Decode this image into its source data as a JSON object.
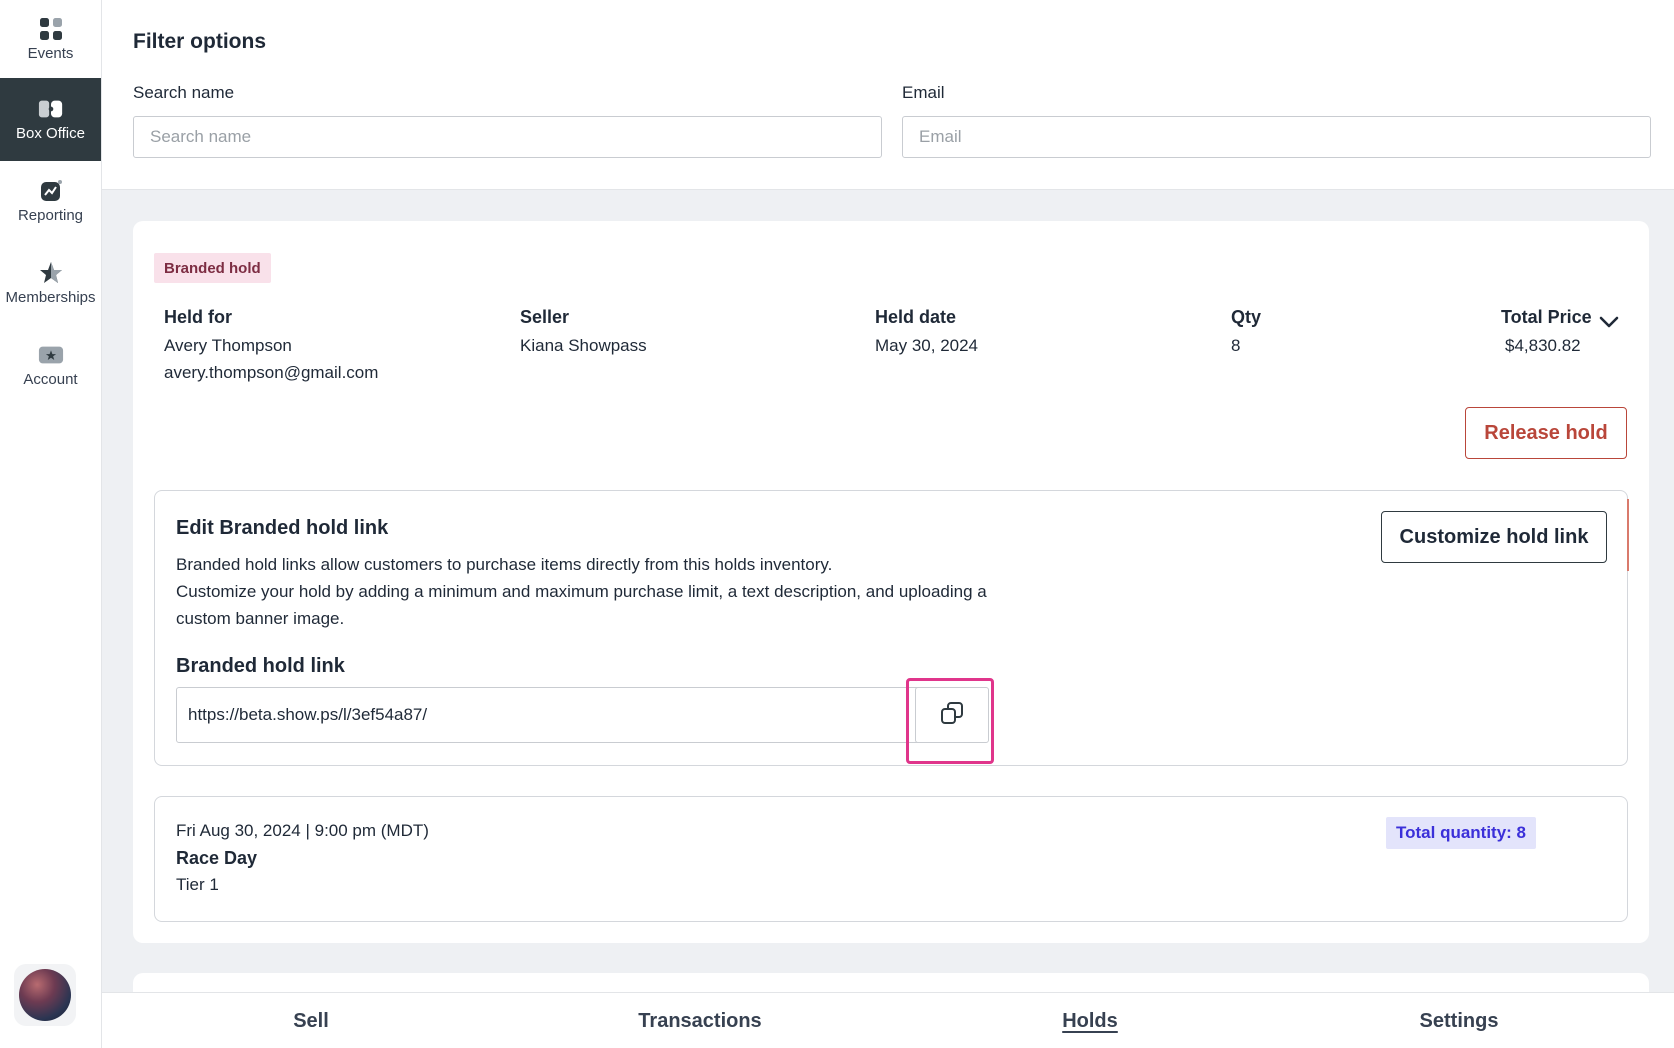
{
  "sidebar": {
    "items": [
      {
        "label": "Events",
        "icon": "grid-icon",
        "active": false
      },
      {
        "label": "Box Office",
        "icon": "box-office-icon",
        "active": true
      },
      {
        "label": "Reporting",
        "icon": "chart-icon",
        "active": false
      },
      {
        "label": "Memberships",
        "icon": "star-icon",
        "active": false
      },
      {
        "label": "Account",
        "icon": "account-badge-icon",
        "active": false
      }
    ],
    "avatar_icon": "user-avatar"
  },
  "filter": {
    "title": "Filter options",
    "search_label": "Search name",
    "search_placeholder": "Search name",
    "email_label": "Email",
    "email_placeholder": "Email"
  },
  "hold": {
    "badge": "Branded hold",
    "columns": {
      "held_for_label": "Held for",
      "held_for_name": "Avery Thompson",
      "held_for_email": "avery.thompson@gmail.com",
      "seller_label": "Seller",
      "seller_value": "Kiana Showpass",
      "held_date_label": "Held date",
      "held_date_value": "May 30, 2024",
      "qty_label": "Qty",
      "qty_value": "8",
      "total_label": "Total Price",
      "total_value": "$4,830.82"
    },
    "release_button": "Release hold",
    "edit": {
      "title": "Edit Branded hold link",
      "desc_line1": "Branded hold links allow customers to purchase items directly from this holds inventory.",
      "desc_line2": "Customize your hold by adding a minimum and maximum purchase limit, a text description, and uploading a custom banner image.",
      "customize_button": "Customize hold link",
      "link_label": "Branded hold link",
      "link_value": "https://beta.show.ps/l/3ef54a87/",
      "copy_icon": "copy-icon"
    },
    "event": {
      "date": "Fri Aug 30, 2024 | 9:00 pm (MDT)",
      "name": "Race Day",
      "tier": "Tier 1",
      "total_quantity": "Total quantity: 8"
    }
  },
  "tabs": [
    {
      "label": "Sell",
      "active": false
    },
    {
      "label": "Transactions",
      "active": false
    },
    {
      "label": "Holds",
      "active": true
    },
    {
      "label": "Settings",
      "active": false
    }
  ],
  "colors": {
    "sidebar_active": "#2f3a40",
    "release": "#b9463a",
    "highlight": "#e0358b",
    "badge_bg": "#f9e1ea",
    "qty_badge_text": "#3b30d9"
  }
}
